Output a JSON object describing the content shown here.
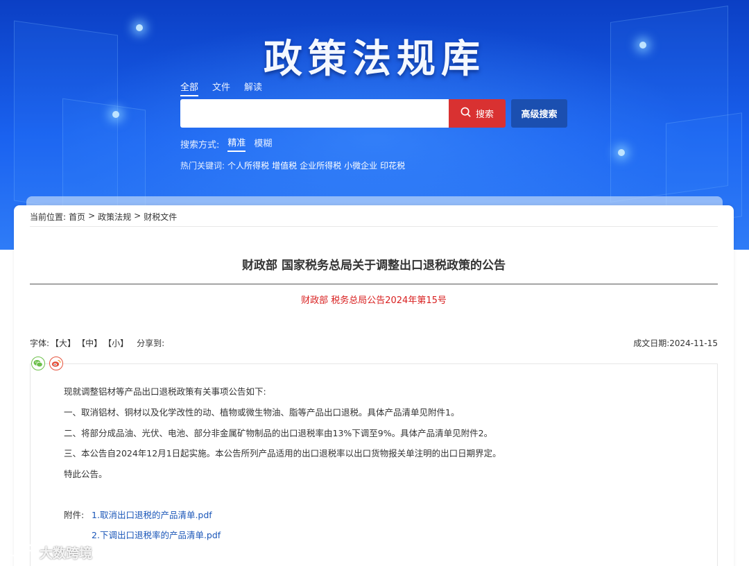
{
  "header": {
    "title": "政策法规库",
    "tabs": [
      {
        "label": "全部",
        "active": true
      },
      {
        "label": "文件",
        "active": false
      },
      {
        "label": "解读",
        "active": false
      }
    ],
    "search": {
      "value": "",
      "placeholder": "",
      "button_label": "搜索",
      "advanced_label": "高级搜索"
    },
    "mode": {
      "label": "搜索方式:",
      "options": [
        {
          "label": "精准",
          "active": true
        },
        {
          "label": "模糊",
          "active": false
        }
      ]
    },
    "hot": {
      "label": "热门关键词:",
      "keywords": [
        "个人所得税",
        "增值税",
        "企业所得税",
        "小微企业",
        "印花税"
      ]
    }
  },
  "breadcrumb": {
    "label": "当前位置:",
    "items": [
      "首页",
      "政策法规",
      "财税文件"
    ],
    "separator": ">"
  },
  "document": {
    "title": "财政部 国家税务总局关于调整出口退税政策的公告",
    "number": "财政部 税务总局公告2024年第15号",
    "font_label": "字体:",
    "sizes": [
      "【大】",
      "【中】",
      "【小】"
    ],
    "share_label": "分享到:",
    "date_label": "成文日期:",
    "date": "2024-11-15",
    "paragraphs": [
      "现就调整铝材等产品出口退税政策有关事项公告如下:",
      "一、取消铝材、铜材以及化学改性的动、植物或微生物油、脂等产品出口退税。具体产品清单见附件1。",
      "二、将部分成品油、光伏、电池、部分非金属矿物制品的出口退税率由13%下调至9%。具体产品清单见附件2。",
      "三、本公告自2024年12月1日起实施。本公告所列产品适用的出口退税率以出口货物报关单注明的出口日期界定。",
      "特此公告。"
    ],
    "attachment_label": "附件:",
    "attachments": [
      {
        "num": "1.",
        "name": "取消出口退税的产品清单.pdf"
      },
      {
        "num": "2.",
        "name": "下调出口退税率的产品清单.pdf"
      }
    ]
  },
  "watermark": "大数跨境",
  "colors": {
    "banner": "#1a62f0",
    "search_button": "#d93131",
    "advanced_button": "#1b4fb0",
    "doc_number": "#d81e1e",
    "link": "#1a56b8"
  },
  "icons": [
    "search-icon",
    "wechat-icon",
    "weibo-icon",
    "watermark-logo-icon"
  ]
}
